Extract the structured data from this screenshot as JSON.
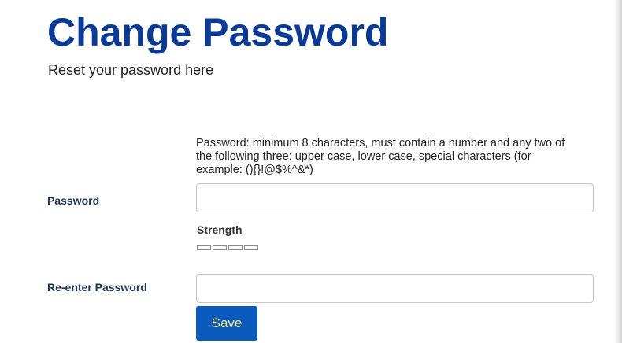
{
  "page": {
    "title": "Change Password",
    "subtitle": "Reset your password here"
  },
  "form": {
    "password_hint": "Password: minimum 8 characters, must contain a number and any two of the following three: upper case, lower case, special characters (for example: (){}!@$%^&*)",
    "password_label": "Password",
    "password_value": "",
    "strength_label": "Strength",
    "strength_level": 0,
    "strength_segments": 4,
    "reenter_label": "Re-enter Password",
    "reenter_value": "",
    "save_label": "Save"
  },
  "colors": {
    "title": "#0a3a99",
    "button_bg": "#0a5bbd",
    "button_text": "#f3e46a",
    "label": "#1c3557"
  }
}
